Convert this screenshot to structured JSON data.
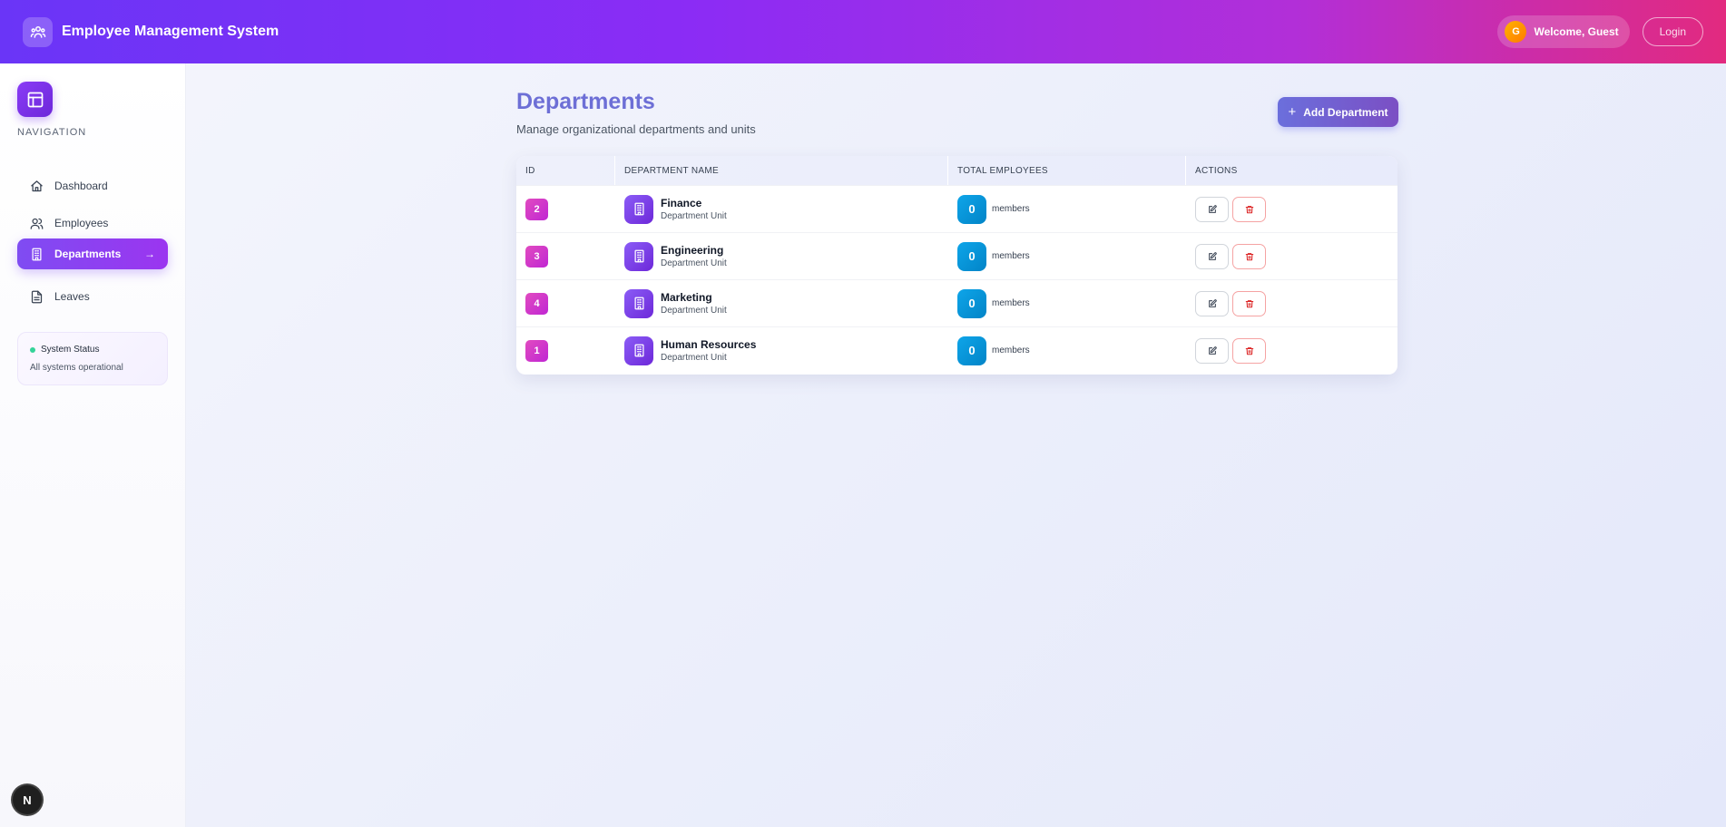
{
  "header": {
    "title": "Employee Management System",
    "welcome": "Welcome, Guest",
    "avatar_initial": "G",
    "login_label": "Login"
  },
  "sidebar": {
    "heading": "NAVIGATION",
    "items": [
      {
        "label": "Dashboard",
        "icon": "home-icon",
        "active": false
      },
      {
        "label": "Employees",
        "icon": "users-icon",
        "active": false
      },
      {
        "label": "Departments",
        "icon": "building-icon",
        "active": true
      },
      {
        "label": "Leaves",
        "icon": "document-icon",
        "active": false
      }
    ],
    "status": {
      "title": "System Status",
      "text": "All systems operational"
    },
    "badge": "N"
  },
  "main": {
    "title": "Departments",
    "subtitle": "Manage organizational departments and units",
    "add_button": "Add Department",
    "columns": [
      "ID",
      "DEPARTMENT NAME",
      "TOTAL EMPLOYEES",
      "ACTIONS"
    ],
    "rows": [
      {
        "id": "2",
        "name": "Finance",
        "sub": "Department Unit",
        "count": "0",
        "unit": "members"
      },
      {
        "id": "3",
        "name": "Engineering",
        "sub": "Department Unit",
        "count": "0",
        "unit": "members"
      },
      {
        "id": "4",
        "name": "Marketing",
        "sub": "Department Unit",
        "count": "0",
        "unit": "members"
      },
      {
        "id": "1",
        "name": "Human Resources",
        "sub": "Department Unit",
        "count": "0",
        "unit": "members"
      }
    ]
  },
  "colors": {
    "header_start": "#6a35f7",
    "header_end": "#e22a7f",
    "accent": "#8b5cf6",
    "title": "#6d6fd6",
    "count_badge": "#0ea5e9",
    "id_badge": "#c026d3",
    "status_ok": "#34d399"
  }
}
